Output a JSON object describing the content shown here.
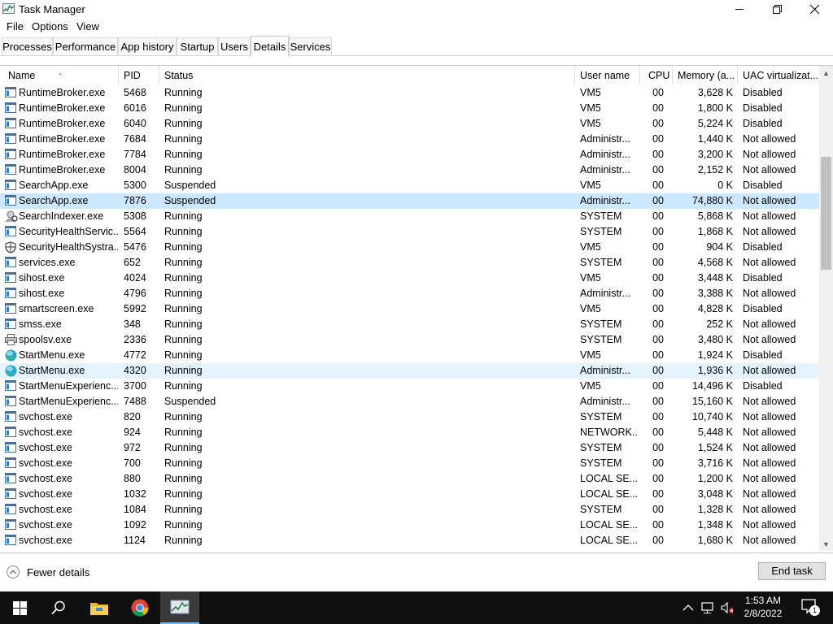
{
  "window": {
    "title": "Task Manager"
  },
  "menu": [
    "File",
    "Options",
    "View"
  ],
  "tabs": [
    {
      "label": "Processes"
    },
    {
      "label": "Performance"
    },
    {
      "label": "App history"
    },
    {
      "label": "Startup"
    },
    {
      "label": "Users"
    },
    {
      "label": "Details",
      "active": true
    },
    {
      "label": "Services"
    }
  ],
  "columns": {
    "name": "Name",
    "pid": "PID",
    "status": "Status",
    "user": "User name",
    "cpu": "CPU",
    "memory": "Memory (a...",
    "uac": "UAC virtualizat..."
  },
  "rows": [
    {
      "icon": "app-window-icon",
      "name": "RuntimeBroker.exe",
      "pid": "5468",
      "status": "Running",
      "user": "VM5",
      "cpu": "00",
      "mem": "3,628 K",
      "uac": "Disabled"
    },
    {
      "icon": "app-window-icon",
      "name": "RuntimeBroker.exe",
      "pid": "6016",
      "status": "Running",
      "user": "VM5",
      "cpu": "00",
      "mem": "1,800 K",
      "uac": "Disabled"
    },
    {
      "icon": "app-window-icon",
      "name": "RuntimeBroker.exe",
      "pid": "6040",
      "status": "Running",
      "user": "VM5",
      "cpu": "00",
      "mem": "5,224 K",
      "uac": "Disabled"
    },
    {
      "icon": "app-window-icon",
      "name": "RuntimeBroker.exe",
      "pid": "7684",
      "status": "Running",
      "user": "Administr...",
      "cpu": "00",
      "mem": "1,440 K",
      "uac": "Not allowed"
    },
    {
      "icon": "app-window-icon",
      "name": "RuntimeBroker.exe",
      "pid": "7784",
      "status": "Running",
      "user": "Administr...",
      "cpu": "00",
      "mem": "3,200 K",
      "uac": "Not allowed"
    },
    {
      "icon": "app-window-icon",
      "name": "RuntimeBroker.exe",
      "pid": "8004",
      "status": "Running",
      "user": "Administr...",
      "cpu": "00",
      "mem": "2,152 K",
      "uac": "Not allowed"
    },
    {
      "icon": "app-window-icon",
      "name": "SearchApp.exe",
      "pid": "5300",
      "status": "Suspended",
      "user": "VM5",
      "cpu": "00",
      "mem": "0 K",
      "uac": "Disabled"
    },
    {
      "icon": "app-window-icon",
      "name": "SearchApp.exe",
      "pid": "7876",
      "status": "Suspended",
      "user": "Administr...",
      "cpu": "00",
      "mem": "74,880 K",
      "uac": "Not allowed",
      "state": "selected"
    },
    {
      "icon": "search-indexer-icon",
      "name": "SearchIndexer.exe",
      "pid": "5308",
      "status": "Running",
      "user": "SYSTEM",
      "cpu": "00",
      "mem": "5,868 K",
      "uac": "Not allowed"
    },
    {
      "icon": "app-window-icon",
      "name": "SecurityHealthServic...",
      "pid": "5564",
      "status": "Running",
      "user": "SYSTEM",
      "cpu": "00",
      "mem": "1,868 K",
      "uac": "Not allowed"
    },
    {
      "icon": "shield-icon",
      "name": "SecurityHealthSystra...",
      "pid": "5476",
      "status": "Running",
      "user": "VM5",
      "cpu": "00",
      "mem": "904 K",
      "uac": "Disabled"
    },
    {
      "icon": "app-window-icon",
      "name": "services.exe",
      "pid": "652",
      "status": "Running",
      "user": "SYSTEM",
      "cpu": "00",
      "mem": "4,568 K",
      "uac": "Not allowed"
    },
    {
      "icon": "app-window-icon",
      "name": "sihost.exe",
      "pid": "4024",
      "status": "Running",
      "user": "VM5",
      "cpu": "00",
      "mem": "3,448 K",
      "uac": "Disabled"
    },
    {
      "icon": "app-window-icon",
      "name": "sihost.exe",
      "pid": "4796",
      "status": "Running",
      "user": "Administr...",
      "cpu": "00",
      "mem": "3,388 K",
      "uac": "Not allowed"
    },
    {
      "icon": "app-window-icon",
      "name": "smartscreen.exe",
      "pid": "5992",
      "status": "Running",
      "user": "VM5",
      "cpu": "00",
      "mem": "4,828 K",
      "uac": "Disabled"
    },
    {
      "icon": "app-window-icon",
      "name": "smss.exe",
      "pid": "348",
      "status": "Running",
      "user": "SYSTEM",
      "cpu": "00",
      "mem": "252 K",
      "uac": "Not allowed"
    },
    {
      "icon": "printer-icon",
      "name": "spoolsv.exe",
      "pid": "2336",
      "status": "Running",
      "user": "SYSTEM",
      "cpu": "00",
      "mem": "3,480 K",
      "uac": "Not allowed"
    },
    {
      "icon": "start-menu-icon",
      "name": "StartMenu.exe",
      "pid": "4772",
      "status": "Running",
      "user": "VM5",
      "cpu": "00",
      "mem": "1,924 K",
      "uac": "Disabled"
    },
    {
      "icon": "start-menu-icon",
      "name": "StartMenu.exe",
      "pid": "4320",
      "status": "Running",
      "user": "Administr...",
      "cpu": "00",
      "mem": "1,936 K",
      "uac": "Not allowed",
      "state": "hover"
    },
    {
      "icon": "app-window-icon",
      "name": "StartMenuExperienc...",
      "pid": "3700",
      "status": "Running",
      "user": "VM5",
      "cpu": "00",
      "mem": "14,496 K",
      "uac": "Disabled"
    },
    {
      "icon": "app-window-icon",
      "name": "StartMenuExperienc...",
      "pid": "7488",
      "status": "Suspended",
      "user": "Administr...",
      "cpu": "00",
      "mem": "15,160 K",
      "uac": "Not allowed"
    },
    {
      "icon": "app-window-icon",
      "name": "svchost.exe",
      "pid": "820",
      "status": "Running",
      "user": "SYSTEM",
      "cpu": "00",
      "mem": "10,740 K",
      "uac": "Not allowed"
    },
    {
      "icon": "app-window-icon",
      "name": "svchost.exe",
      "pid": "924",
      "status": "Running",
      "user": "NETWORK...",
      "cpu": "00",
      "mem": "5,448 K",
      "uac": "Not allowed"
    },
    {
      "icon": "app-window-icon",
      "name": "svchost.exe",
      "pid": "972",
      "status": "Running",
      "user": "SYSTEM",
      "cpu": "00",
      "mem": "1,524 K",
      "uac": "Not allowed"
    },
    {
      "icon": "app-window-icon",
      "name": "svchost.exe",
      "pid": "700",
      "status": "Running",
      "user": "SYSTEM",
      "cpu": "00",
      "mem": "3,716 K",
      "uac": "Not allowed"
    },
    {
      "icon": "app-window-icon",
      "name": "svchost.exe",
      "pid": "880",
      "status": "Running",
      "user": "LOCAL SE...",
      "cpu": "00",
      "mem": "1,200 K",
      "uac": "Not allowed"
    },
    {
      "icon": "app-window-icon",
      "name": "svchost.exe",
      "pid": "1032",
      "status": "Running",
      "user": "LOCAL SE...",
      "cpu": "00",
      "mem": "3,048 K",
      "uac": "Not allowed"
    },
    {
      "icon": "app-window-icon",
      "name": "svchost.exe",
      "pid": "1084",
      "status": "Running",
      "user": "SYSTEM",
      "cpu": "00",
      "mem": "1,328 K",
      "uac": "Not allowed"
    },
    {
      "icon": "app-window-icon",
      "name": "svchost.exe",
      "pid": "1092",
      "status": "Running",
      "user": "LOCAL SE...",
      "cpu": "00",
      "mem": "1,348 K",
      "uac": "Not allowed"
    },
    {
      "icon": "app-window-icon",
      "name": "svchost.exe",
      "pid": "1124",
      "status": "Running",
      "user": "LOCAL SE...",
      "cpu": "00",
      "mem": "1,680 K",
      "uac": "Not allowed"
    }
  ],
  "footer": {
    "fewer_details": "Fewer details",
    "end_task": "End task"
  },
  "taskbar": {
    "time": "1:53 AM",
    "date": "2/8/2022",
    "notification_count": "1",
    "apps": [
      "start-icon",
      "search-icon",
      "file-explorer-icon",
      "chrome-icon",
      "task-manager-icon"
    ]
  },
  "colors": {
    "selected_row": "#cce8ff",
    "hover_row": "#e5f3ff",
    "taskbar": "#101010"
  }
}
